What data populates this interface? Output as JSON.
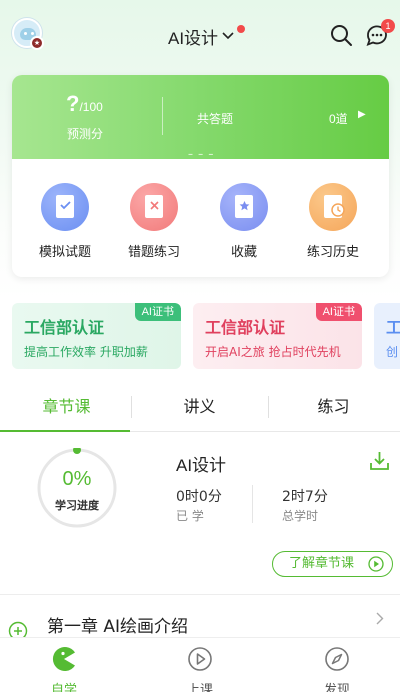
{
  "header": {
    "title": "AI设计",
    "message_badge": "1"
  },
  "score_card": {
    "score_value": "?",
    "score_denominator": "/100",
    "score_label": "预测分",
    "total_label": "共答题",
    "total_value": "0道",
    "dashes": "– – –"
  },
  "quick_actions": [
    {
      "label": "模拟试题",
      "icon": "exam-paper-icon",
      "color": "#6b8ff2"
    },
    {
      "label": "错题练习",
      "icon": "wrong-questions-icon",
      "color": "#f27a7a"
    },
    {
      "label": "收藏",
      "icon": "bookmark-icon",
      "color": "#7a8ef0"
    },
    {
      "label": "练习历史",
      "icon": "history-icon",
      "color": "#f5a65a"
    }
  ],
  "banners": [
    {
      "title": "工信部认证",
      "subtitle": "提高工作效率 升职加薪",
      "tag": "AI证书",
      "accent": "#3cbf7a"
    },
    {
      "title": "工信部认证",
      "subtitle": "开启AI之旅 抢占时代先机",
      "tag": "AI证书",
      "accent": "#f0506e"
    },
    {
      "title": "工",
      "subtitle": "创",
      "tag": "",
      "accent": "#5a8ef0"
    }
  ],
  "tabs": [
    "章节课",
    "讲义",
    "练习"
  ],
  "progress": {
    "percent": "0%",
    "percent_value": 0,
    "label": "学习进度",
    "course_name": "AI设计",
    "studied_value": "0时0分",
    "studied_label": "已 学",
    "total_value": "2时7分",
    "total_label": "总学时",
    "learn_button": "了解章节课"
  },
  "chapter": {
    "title": "第一章 AI绘画介绍"
  },
  "bottom_nav": [
    {
      "label": "自学",
      "icon": "pacman-icon",
      "active": true
    },
    {
      "label": "上课",
      "icon": "play-circle-icon",
      "active": false
    },
    {
      "label": "发现",
      "icon": "compass-icon",
      "active": false
    }
  ],
  "colors": {
    "accent_green": "#55bb33"
  }
}
